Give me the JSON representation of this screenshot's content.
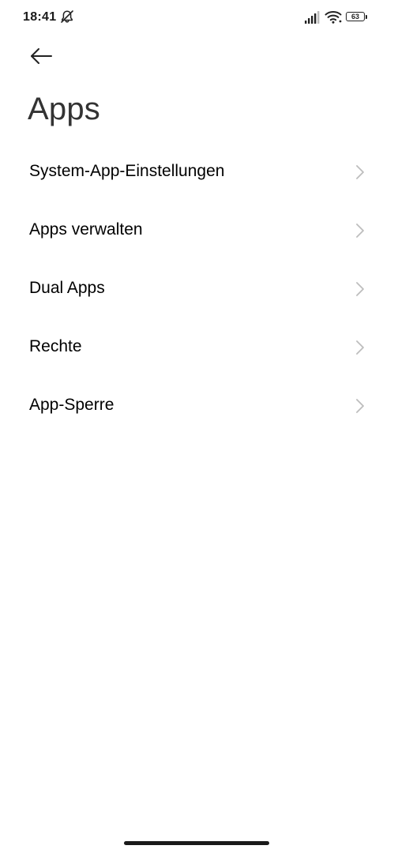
{
  "status_bar": {
    "time": "18:41",
    "battery_level": "63",
    "icons": [
      "dnd-off-icon",
      "signal-icon",
      "wifi-icon",
      "battery-icon"
    ]
  },
  "header": {
    "back_icon": "arrow-left-icon",
    "title": "Apps"
  },
  "menu": {
    "items": [
      {
        "label": "System-App-Einstellungen",
        "icon": "chevron-right-icon"
      },
      {
        "label": "Apps verwalten",
        "icon": "chevron-right-icon"
      },
      {
        "label": "Dual Apps",
        "icon": "chevron-right-icon"
      },
      {
        "label": "Rechte",
        "icon": "chevron-right-icon"
      },
      {
        "label": "App-Sperre",
        "icon": "chevron-right-icon"
      }
    ]
  },
  "colors": {
    "background": "#ffffff",
    "text_primary": "#000000",
    "title_text": "#333333",
    "chevron": "#bdbdbd"
  }
}
